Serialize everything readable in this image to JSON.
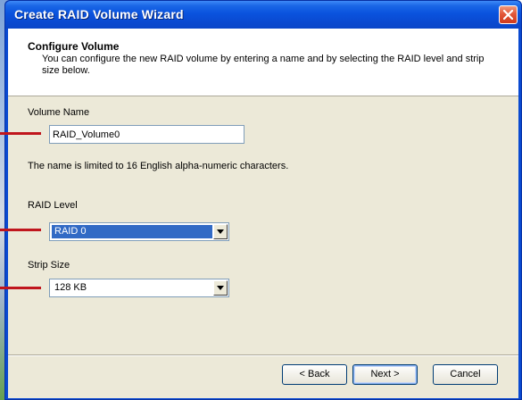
{
  "window": {
    "title": "Create RAID Volume Wizard"
  },
  "header": {
    "title": "Configure Volume",
    "description": "You can configure the new RAID volume by entering a name and by selecting the RAID level and strip size below."
  },
  "form": {
    "volume_name": {
      "label": "Volume Name",
      "value": "RAID_Volume0",
      "hint": "The name is limited to 16 English alpha-numeric characters."
    },
    "raid_level": {
      "label": "RAID Level",
      "selected": "RAID 0"
    },
    "strip_size": {
      "label": "Strip Size",
      "selected": "128 KB"
    }
  },
  "buttons": {
    "back": "< Back",
    "next": "Next >",
    "cancel": "Cancel"
  },
  "colors": {
    "annotation_pointer": "#c0161d",
    "selection_highlight": "#316ac5"
  },
  "icons": {
    "close": "close-x-icon",
    "dropdown": "chevron-down-icon"
  }
}
